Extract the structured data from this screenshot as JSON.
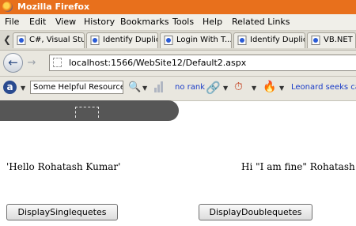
{
  "window": {
    "title": "Mozilla Firefox"
  },
  "menubar": {
    "items": [
      "File",
      "Edit",
      "View",
      "History",
      "Bookmarks",
      "Tools",
      "Help",
      "Related Links"
    ]
  },
  "tabs": [
    {
      "label": "C#, Visual Stu..."
    },
    {
      "label": "Identify Duplic..."
    },
    {
      "label": "Login With T..."
    },
    {
      "label": "Identify Duplic..."
    },
    {
      "label": "VB.NET"
    }
  ],
  "nav": {
    "url": "localhost:1566/WebSite12/Default2.aspx"
  },
  "toolbar": {
    "resources_label": "Some Helpful Resources",
    "rank_text": "no rank",
    "leonard_text": "Leonard seeks ca"
  },
  "content": {
    "left_text": "'Hello Rohatash Kumar'",
    "right_text": "Hi \"I am fine\" Rohatash",
    "single_button": "DisplaySinglequetes",
    "double_button": "DisplayDoublequetes"
  },
  "colors": {
    "titlebar": "#e8701c",
    "link": "#1a3cc8"
  }
}
